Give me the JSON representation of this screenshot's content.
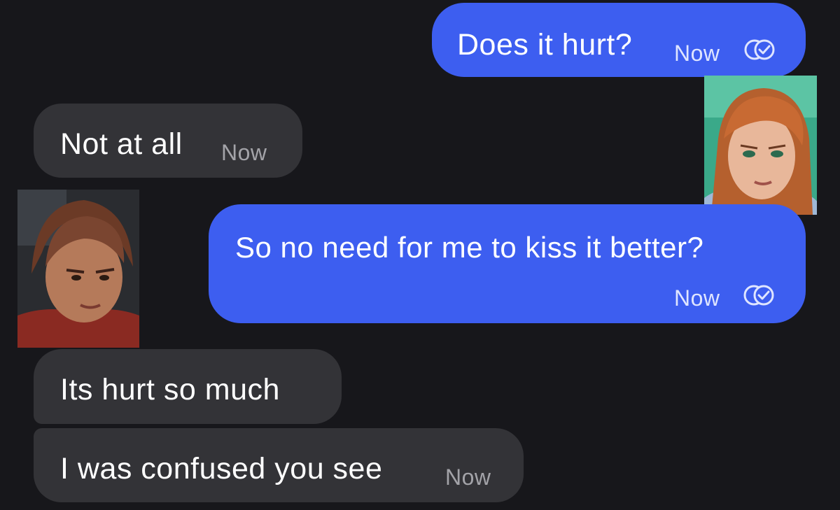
{
  "messages": [
    {
      "text": "Does it hurt?",
      "time": "Now",
      "direction": "sent",
      "status": "read"
    },
    {
      "text": "Not at all",
      "time": "Now",
      "direction": "received"
    },
    {
      "text": "So no need for me to kiss it better?",
      "time": "Now",
      "direction": "sent",
      "status": "read"
    },
    {
      "text": "Its hurt so much",
      "direction": "received"
    },
    {
      "text": "I was confused you see",
      "time": "Now",
      "direction": "received"
    }
  ],
  "colors": {
    "background": "#17171b",
    "sent_bubble": "#3d5ef0",
    "received_bubble": "#333337",
    "text": "#ffffff"
  },
  "avatars": {
    "sender": "avatar-portrait-orange-hair",
    "receiver": "avatar-portrait-brown-hair"
  }
}
